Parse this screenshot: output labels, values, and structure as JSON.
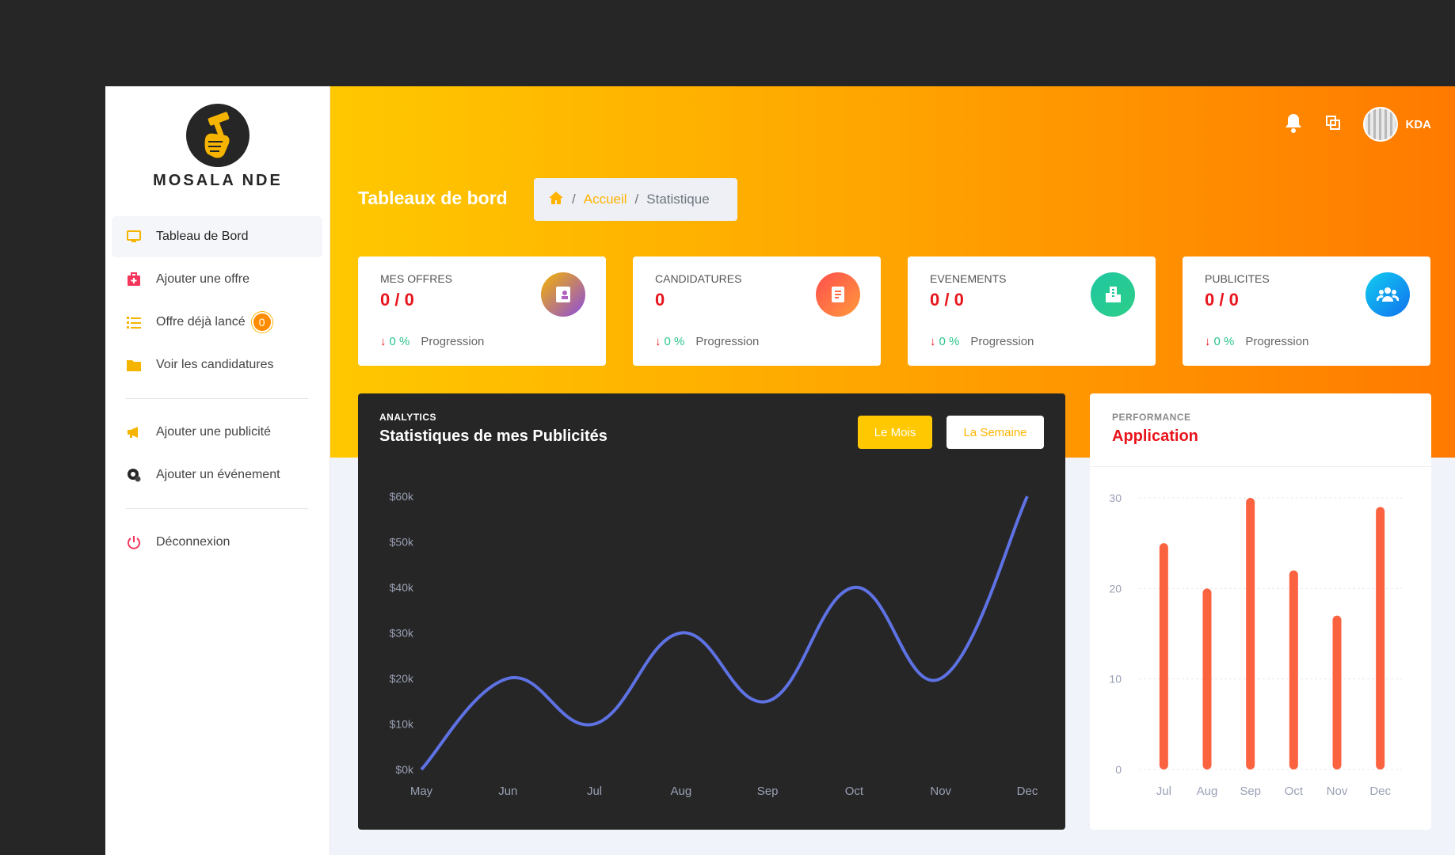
{
  "brand": {
    "name": "MOSALA NDE"
  },
  "sidebar": {
    "items": [
      {
        "label": "Tableau de Bord",
        "icon": "monitor-icon"
      },
      {
        "label": "Ajouter une offre",
        "icon": "briefcase-add-icon"
      },
      {
        "label": "Offre déjà lancé",
        "icon": "list-icon",
        "count": "0"
      },
      {
        "label": "Voir les candidatures",
        "icon": "folder-icon"
      },
      {
        "label": "Ajouter une publicité",
        "icon": "megaphone-icon"
      },
      {
        "label": "Ajouter un événement",
        "icon": "event-icon"
      },
      {
        "label": "Déconnexion",
        "icon": "power-icon"
      }
    ]
  },
  "topbar": {
    "user": "KDA",
    "icons": [
      "bell-icon",
      "windows-icon",
      "avatar"
    ]
  },
  "header": {
    "title": "Tableaux de bord",
    "breadcrumb": {
      "home_icon": "home-icon",
      "sep": "/",
      "link": "Accueil",
      "current": "Statistique"
    }
  },
  "cards": [
    {
      "label": "MES OFFRES",
      "value": "0 / 0",
      "pct": "0 %",
      "foot": "Progression",
      "icon": "contact-icon",
      "color": "#c05fb0"
    },
    {
      "label": "CANDIDATURES",
      "value": "0",
      "pct": "0 %",
      "foot": "Progression",
      "icon": "document-icon",
      "color": "#ff6a3d"
    },
    {
      "label": "EVENEMENTS",
      "value": "0 / 0",
      "pct": "0 %",
      "foot": "Progression",
      "icon": "building-icon",
      "color": "#1fc7a0"
    },
    {
      "label": "PUBLICITES",
      "value": "0 / 0",
      "pct": "0 %",
      "foot": "Progression",
      "icon": "users-icon",
      "color": "#1b8ff0"
    }
  ],
  "analytics": {
    "kicker": "ANALYTICS",
    "title": "Statistiques de mes Publicités",
    "btn_month": "Le Mois",
    "btn_week": "La Semaine"
  },
  "performance": {
    "kicker": "PERFORMANCE",
    "title": "Application"
  },
  "chart_data": [
    {
      "type": "line",
      "title": "Statistiques de mes Publicités",
      "categories": [
        "May",
        "Jun",
        "Jul",
        "Aug",
        "Sep",
        "Oct",
        "Nov",
        "Dec"
      ],
      "values": [
        0,
        20,
        10,
        30,
        15,
        40,
        20,
        60
      ],
      "yticks": [
        "$0k",
        "$10k",
        "$20k",
        "$30k",
        "$40k",
        "$50k",
        "$60k"
      ],
      "ylim": [
        0,
        60
      ],
      "color": "#5e72e4",
      "grid": false
    },
    {
      "type": "bar",
      "title": "Application",
      "categories": [
        "Jul",
        "Aug",
        "Sep",
        "Oct",
        "Nov",
        "Dec"
      ],
      "values": [
        25,
        20,
        30,
        22,
        17,
        29
      ],
      "yticks": [
        "0",
        "10",
        "20",
        "30"
      ],
      "ylim": [
        0,
        30
      ],
      "color": "#fb6340",
      "grid": true
    }
  ]
}
